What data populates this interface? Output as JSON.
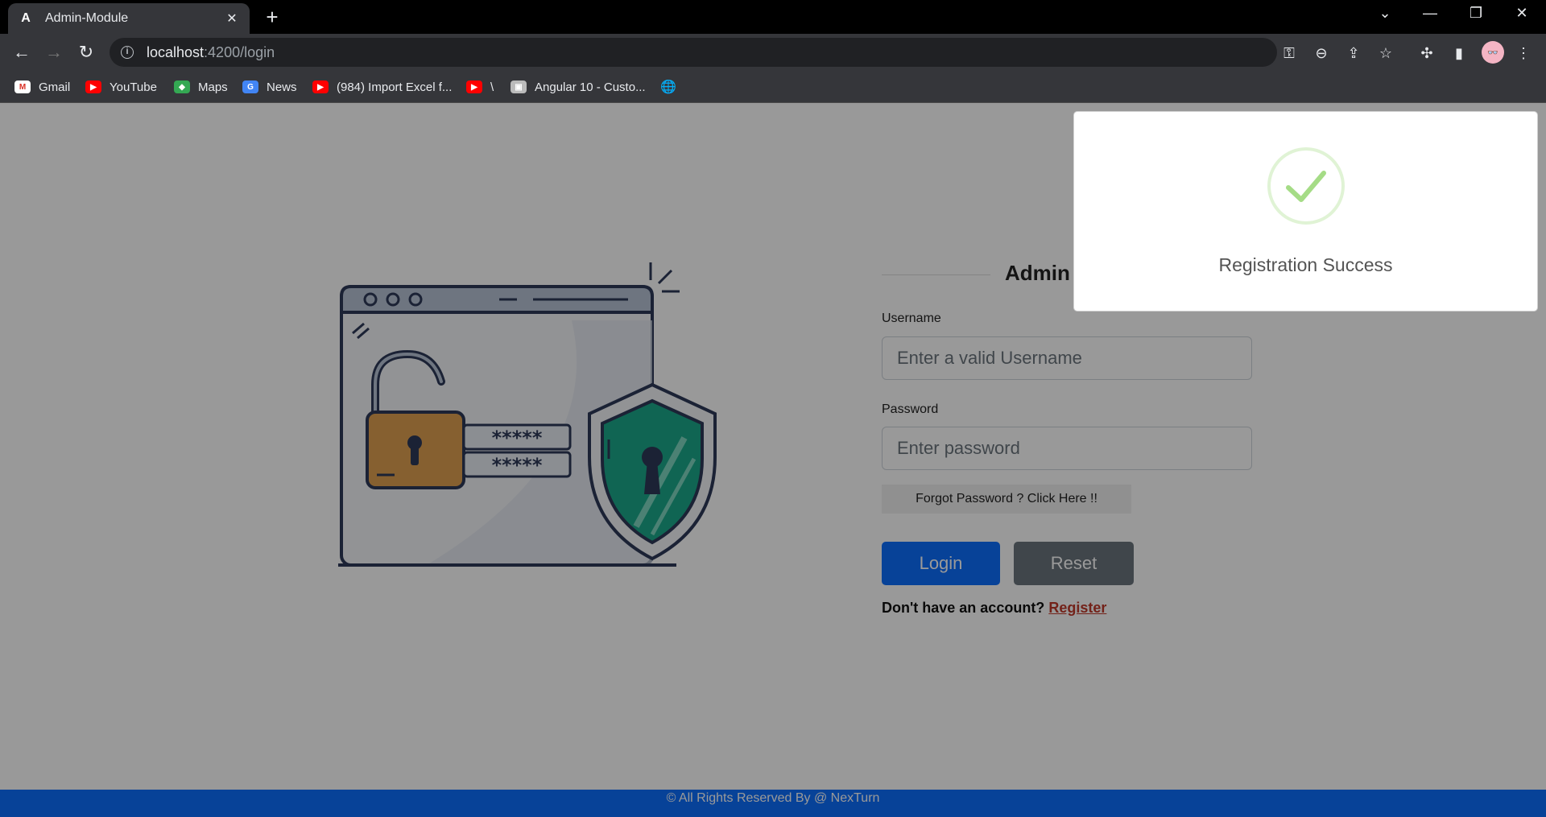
{
  "browser": {
    "tab_title": "Admin-Module",
    "url_host": "localhost",
    "url_rest": ":4200/login",
    "bookmarks": [
      {
        "label": "Gmail",
        "icon": "gmail-icon"
      },
      {
        "label": "YouTube",
        "icon": "youtube-icon"
      },
      {
        "label": "Maps",
        "icon": "maps-icon"
      },
      {
        "label": "News",
        "icon": "news-icon"
      },
      {
        "label": "(984) Import Excel f...",
        "icon": "youtube-icon"
      },
      {
        "label": "\\",
        "icon": "youtube-icon"
      },
      {
        "label": "Angular 10 - Custo...",
        "icon": "site-icon"
      },
      {
        "label": "",
        "icon": "globe-icon"
      }
    ]
  },
  "login": {
    "title": "Admin",
    "username_label": "Username",
    "username_placeholder": "Enter a valid Username",
    "password_label": "Password",
    "password_placeholder": "Enter password",
    "forgot_label": "Forgot Password ? Click Here !!",
    "login_label": "Login",
    "reset_label": "Reset",
    "register_prompt": "Don't have an account?",
    "register_link": "Register"
  },
  "footer": {
    "text": "© All Rights Reserved By @ NexTurn"
  },
  "alert": {
    "title": "Registration Success",
    "icon": "success-check-icon"
  },
  "colors": {
    "primary": "#0d6efd",
    "secondary": "#6c757d",
    "register_link": "#c0392b",
    "success_check": "#a5dc86",
    "lock": "#e0a050",
    "shield": "#1ba98a"
  }
}
